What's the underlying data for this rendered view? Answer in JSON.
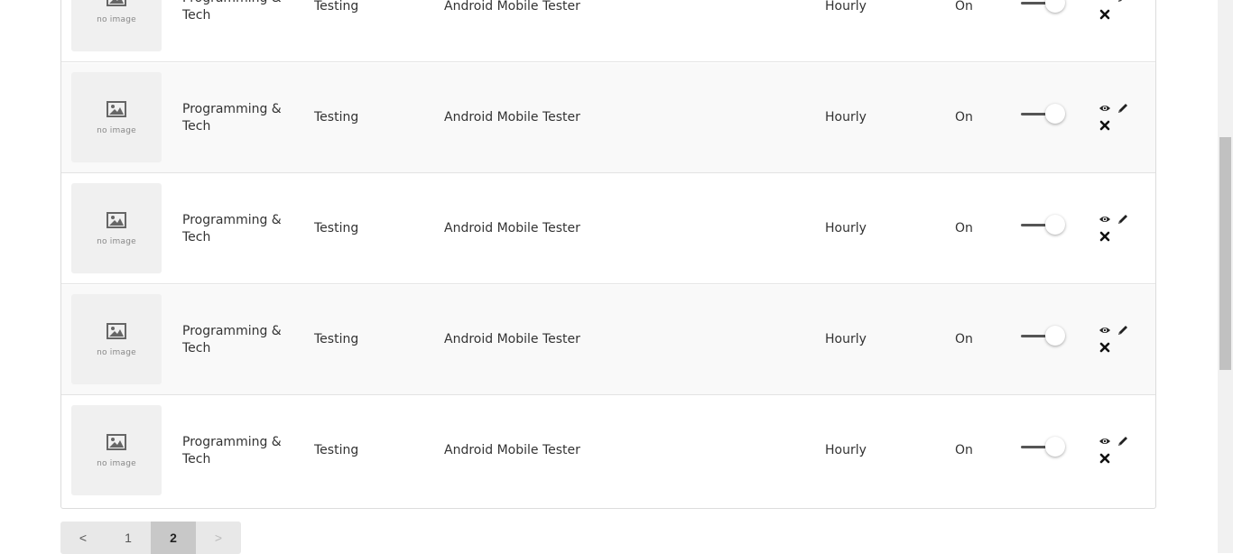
{
  "rows": [
    {
      "thumb_text": "no image",
      "category": "Programming & Tech",
      "subcategory": "Testing",
      "title": "Android Mobile Tester",
      "type": "Hourly",
      "status": "On",
      "enabled": true
    },
    {
      "thumb_text": "no image",
      "category": "Programming & Tech",
      "subcategory": "Testing",
      "title": "Android Mobile Tester",
      "type": "Hourly",
      "status": "On",
      "enabled": true
    },
    {
      "thumb_text": "no image",
      "category": "Programming & Tech",
      "subcategory": "Testing",
      "title": "Android Mobile Tester",
      "type": "Hourly",
      "status": "On",
      "enabled": true
    },
    {
      "thumb_text": "no image",
      "category": "Programming & Tech",
      "subcategory": "Testing",
      "title": "Android Mobile Tester",
      "type": "Hourly",
      "status": "On",
      "enabled": true
    },
    {
      "thumb_text": "no image",
      "category": "Programming & Tech",
      "subcategory": "Testing",
      "title": "Android Mobile Tester",
      "type": "Hourly",
      "status": "On",
      "enabled": true
    }
  ],
  "icons": {
    "view": "eye-icon",
    "edit": "pencil-icon",
    "delete": "close-icon",
    "thumb": "image-placeholder-icon"
  },
  "pagination": {
    "prev": "<",
    "pages": [
      "1",
      "2"
    ],
    "current": "2",
    "next": ">"
  }
}
